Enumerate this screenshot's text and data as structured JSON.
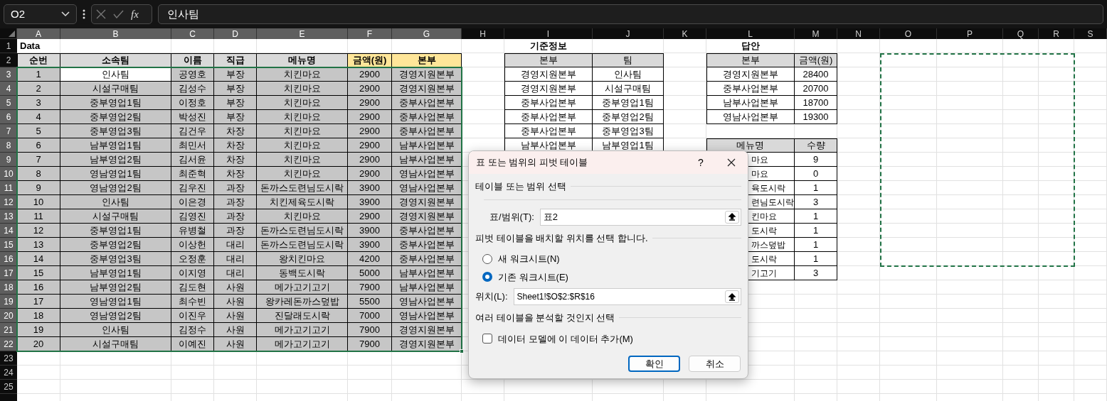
{
  "name_box": {
    "value": "O2"
  },
  "formula_bar": {
    "function_label": "fx",
    "value": "인사팀"
  },
  "column_headers": [
    {
      "label": "A",
      "selected": true
    },
    {
      "label": "B",
      "selected": true
    },
    {
      "label": "C",
      "selected": true
    },
    {
      "label": "D",
      "selected": true
    },
    {
      "label": "E",
      "selected": true
    },
    {
      "label": "F",
      "selected": true
    },
    {
      "label": "G",
      "selected": true
    },
    {
      "label": "H",
      "selected": false
    },
    {
      "label": "I",
      "selected": false
    },
    {
      "label": "J",
      "selected": false
    },
    {
      "label": "K",
      "selected": false
    },
    {
      "label": "L",
      "selected": false
    },
    {
      "label": "M",
      "selected": false
    },
    {
      "label": "N",
      "selected": false
    },
    {
      "label": "O",
      "selected": false
    },
    {
      "label": "P",
      "selected": false
    },
    {
      "label": "Q",
      "selected": false
    },
    {
      "label": "R",
      "selected": false
    },
    {
      "label": "S",
      "selected": false
    }
  ],
  "row_headers": [
    {
      "label": "1",
      "selected": false
    },
    {
      "label": "2",
      "selected": false
    },
    {
      "label": "3",
      "selected": true
    },
    {
      "label": "4",
      "selected": true
    },
    {
      "label": "5",
      "selected": true
    },
    {
      "label": "6",
      "selected": true
    },
    {
      "label": "7",
      "selected": true
    },
    {
      "label": "8",
      "selected": true
    },
    {
      "label": "9",
      "selected": true
    },
    {
      "label": "10",
      "selected": true
    },
    {
      "label": "11",
      "selected": true
    },
    {
      "label": "12",
      "selected": true
    },
    {
      "label": "13",
      "selected": true
    },
    {
      "label": "14",
      "selected": true
    },
    {
      "label": "15",
      "selected": true
    },
    {
      "label": "16",
      "selected": true
    },
    {
      "label": "17",
      "selected": true
    },
    {
      "label": "18",
      "selected": true
    },
    {
      "label": "19",
      "selected": true
    },
    {
      "label": "20",
      "selected": true
    },
    {
      "label": "21",
      "selected": true
    },
    {
      "label": "22",
      "selected": true
    },
    {
      "label": "23",
      "selected": false
    },
    {
      "label": "24",
      "selected": false
    },
    {
      "label": "25",
      "selected": false
    }
  ],
  "data_table": {
    "title": "Data",
    "selected": true,
    "headers": [
      {
        "text": "순번",
        "color": "#d9d9d9"
      },
      {
        "text": "소속팀",
        "color": "#d9d9d9"
      },
      {
        "text": "이름",
        "color": "#d9d9d9"
      },
      {
        "text": "직급",
        "color": "#d9d9d9"
      },
      {
        "text": "메뉴명",
        "color": "#d9d9d9"
      },
      {
        "text": "금액(원)",
        "color": "#ffe699"
      },
      {
        "text": "본부",
        "color": "#ffe699"
      }
    ],
    "rows": [
      {
        "cells": [
          "1",
          "인사팀",
          "공영호",
          "부장",
          "치킨마요",
          "2900",
          "경영지원본부"
        ],
        "active": [
          false,
          true,
          false,
          false,
          false,
          false,
          false
        ]
      },
      {
        "cells": [
          "2",
          "시설구매팀",
          "김성수",
          "부장",
          "치킨마요",
          "2900",
          "경영지원본부"
        ],
        "active": [
          false,
          false,
          false,
          false,
          false,
          false,
          false
        ]
      },
      {
        "cells": [
          "3",
          "중부영업1팀",
          "이정호",
          "부장",
          "치킨마요",
          "2900",
          "중부사업본부"
        ],
        "active": [
          false,
          false,
          false,
          false,
          false,
          false,
          false
        ]
      },
      {
        "cells": [
          "4",
          "중부영업2팀",
          "박성진",
          "부장",
          "치킨마요",
          "2900",
          "중부사업본부"
        ],
        "active": [
          false,
          false,
          false,
          false,
          false,
          false,
          false
        ]
      },
      {
        "cells": [
          "5",
          "중부영업3팀",
          "김건우",
          "차장",
          "치킨마요",
          "2900",
          "중부사업본부"
        ],
        "active": [
          false,
          false,
          false,
          false,
          false,
          false,
          false
        ]
      },
      {
        "cells": [
          "6",
          "남부영업1팀",
          "최민서",
          "차장",
          "치킨마요",
          "2900",
          "남부사업본부"
        ],
        "active": [
          false,
          false,
          false,
          false,
          false,
          false,
          false
        ]
      },
      {
        "cells": [
          "7",
          "남부영업2팀",
          "김서윤",
          "차장",
          "치킨마요",
          "2900",
          "남부사업본부"
        ],
        "active": [
          false,
          false,
          false,
          false,
          false,
          false,
          false
        ]
      },
      {
        "cells": [
          "8",
          "영남영업1팀",
          "최준혁",
          "차장",
          "치킨마요",
          "2900",
          "영남사업본부"
        ],
        "active": [
          false,
          false,
          false,
          false,
          false,
          false,
          false
        ]
      },
      {
        "cells": [
          "9",
          "영남영업2팀",
          "김우진",
          "과장",
          "돈까스도련님도시락",
          "3900",
          "영남사업본부"
        ],
        "active": [
          false,
          false,
          false,
          false,
          false,
          false,
          false
        ]
      },
      {
        "cells": [
          "10",
          "인사팀",
          "이은경",
          "과장",
          "치킨제육도시락",
          "3900",
          "경영지원본부"
        ],
        "active": [
          false,
          false,
          false,
          false,
          false,
          false,
          false
        ]
      },
      {
        "cells": [
          "11",
          "시설구매팀",
          "김영진",
          "과장",
          "치킨마요",
          "2900",
          "경영지원본부"
        ],
        "active": [
          false,
          false,
          false,
          false,
          false,
          false,
          false
        ]
      },
      {
        "cells": [
          "12",
          "중부영업1팀",
          "유병철",
          "과장",
          "돈까스도련님도시락",
          "3900",
          "중부사업본부"
        ],
        "active": [
          false,
          false,
          false,
          false,
          false,
          false,
          false
        ]
      },
      {
        "cells": [
          "13",
          "중부영업2팀",
          "이상헌",
          "대리",
          "돈까스도련님도시락",
          "3900",
          "중부사업본부"
        ],
        "active": [
          false,
          false,
          false,
          false,
          false,
          false,
          false
        ]
      },
      {
        "cells": [
          "14",
          "중부영업3팀",
          "오정훈",
          "대리",
          "왕치킨마요",
          "4200",
          "중부사업본부"
        ],
        "active": [
          false,
          false,
          false,
          false,
          false,
          false,
          false
        ]
      },
      {
        "cells": [
          "15",
          "남부영업1팀",
          "이지영",
          "대리",
          "동백도시락",
          "5000",
          "남부사업본부"
        ],
        "active": [
          false,
          false,
          false,
          false,
          false,
          false,
          false
        ]
      },
      {
        "cells": [
          "16",
          "남부영업2팀",
          "김도현",
          "사원",
          "메가고기고기",
          "7900",
          "남부사업본부"
        ],
        "active": [
          false,
          false,
          false,
          false,
          false,
          false,
          false
        ]
      },
      {
        "cells": [
          "17",
          "영남영업1팀",
          "최수빈",
          "사원",
          "왕카레돈까스덮밥",
          "5500",
          "영남사업본부"
        ],
        "active": [
          false,
          false,
          false,
          false,
          false,
          false,
          false
        ]
      },
      {
        "cells": [
          "18",
          "영남영업2팀",
          "이진우",
          "사원",
          "진달래도시락",
          "7000",
          "영남사업본부"
        ],
        "active": [
          false,
          false,
          false,
          false,
          false,
          false,
          false
        ]
      },
      {
        "cells": [
          "19",
          "인사팀",
          "김정수",
          "사원",
          "메가고기고기",
          "7900",
          "경영지원본부"
        ],
        "active": [
          false,
          false,
          false,
          false,
          false,
          false,
          false
        ]
      },
      {
        "cells": [
          "20",
          "시설구매팀",
          "이예진",
          "사원",
          "메가고기고기",
          "7900",
          "경영지원본부"
        ],
        "active": [
          false,
          false,
          false,
          false,
          false,
          false,
          false
        ]
      }
    ]
  },
  "reference_table": {
    "title": "기준정보",
    "headers": [
      "본부",
      "팀"
    ],
    "rows": [
      [
        "경영지원본부",
        "인사팀"
      ],
      [
        "경영지원본부",
        "시설구매팀"
      ],
      [
        "중부사업본부",
        "중부영업1팀"
      ],
      [
        "중부사업본부",
        "중부영업2팀"
      ],
      [
        "중부사업본부",
        "중부영업3팀"
      ],
      [
        "남부사업본부",
        "남부영업1팀"
      ]
    ]
  },
  "answer_table": {
    "title": "답안",
    "headers": [
      "본부",
      "금액(원)"
    ],
    "rows": [
      [
        "경영지원본부",
        "28400"
      ],
      [
        "중부사업본부",
        "20700"
      ],
      [
        "남부사업본부",
        "18700"
      ],
      [
        "영남사업본부",
        "19300"
      ]
    ]
  },
  "menu_table": {
    "headers": [
      "메뉴명",
      "수량"
    ],
    "rows": [
      [
        "마요",
        "9"
      ],
      [
        "마요",
        "0"
      ],
      [
        "육도시락",
        "1"
      ],
      [
        "련님도시락",
        "3"
      ],
      [
        "킨마요",
        "1"
      ],
      [
        "도시락",
        "1"
      ],
      [
        "까스덮밥",
        "1"
      ],
      [
        "도시락",
        "1"
      ],
      [
        "기고기",
        "3"
      ]
    ]
  },
  "dialog": {
    "title": "표 또는 범위의 피벗 테이블",
    "help": "?",
    "section_1": "테이블 또는 범위 선택",
    "range_field": {
      "label": "표/범위(T):",
      "value": "표2"
    },
    "section_2": "피벗 테이블을 배치할 위치를 선택 합니다.",
    "radios": [
      {
        "label": "새 워크시트(N)",
        "selected": false
      },
      {
        "label": "기존 워크시트(E)",
        "selected": true
      }
    ],
    "location_field": {
      "label": "위치(L):",
      "value": "Sheet1!$O$2:$R$16"
    },
    "section_3": "여러 테이블을 분석할 것인지 선택",
    "checkbox": {
      "label": "데이터 모델에 이 데이터 추가(M)",
      "checked": false
    },
    "buttons": [
      {
        "label": "확인",
        "default": true
      },
      {
        "label": "취소",
        "default": false
      }
    ]
  }
}
